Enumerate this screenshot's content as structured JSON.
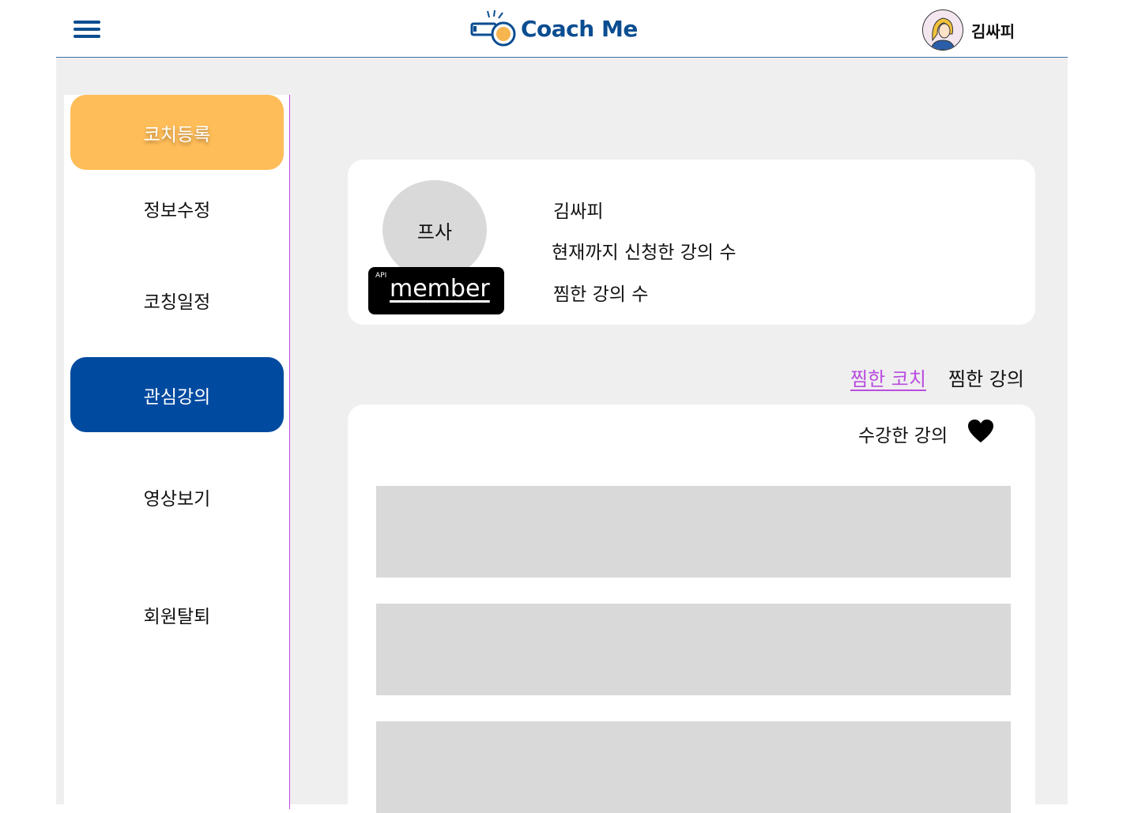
{
  "header": {
    "logo_text": "Coach Me",
    "user_name": "김싸피",
    "brand_color": "#0b4d91"
  },
  "sidebar": {
    "items": [
      {
        "label": "코치등록",
        "style": "orange"
      },
      {
        "label": "정보수정",
        "style": "plain"
      },
      {
        "label": "코칭일정",
        "style": "plain"
      },
      {
        "label": "관심강의",
        "style": "blue"
      },
      {
        "label": "영상보기",
        "style": "plain"
      },
      {
        "label": "회원탈퇴",
        "style": "plain"
      }
    ]
  },
  "profile": {
    "photo_label": "프사",
    "api_small": "API",
    "api_label": "member",
    "name": "김싸피",
    "applied_label": "현재까지 신청한 강의 수",
    "liked_label": "찜한 강의 수"
  },
  "tabs": [
    {
      "label": "찜한 코치",
      "active": true
    },
    {
      "label": "찜한 강의",
      "active": false
    }
  ],
  "list": {
    "heading": "수강한 강의",
    "icon": "heart-icon"
  },
  "colors": {
    "accent_orange": "#ffbd59",
    "accent_blue": "#004aa0",
    "tab_active": "#b94ce0",
    "placeholder_gray": "#d9d9d9",
    "page_bg": "#efefef"
  }
}
